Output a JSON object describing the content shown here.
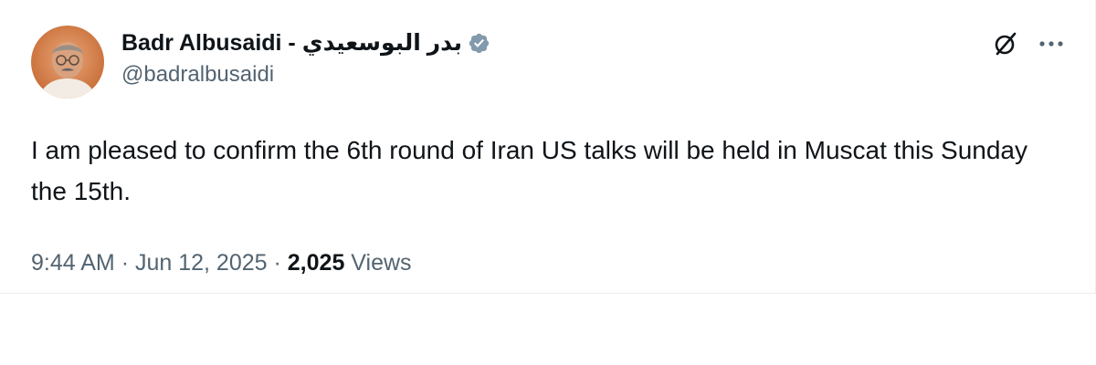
{
  "author": {
    "display_name": "Badr Albusaidi - بدر البوسعيدي",
    "handle": "@badralbusaidi",
    "verified": true,
    "avatar_icon": "profile-photo"
  },
  "actions": {
    "grok_icon": "grok-icon",
    "more_icon": "more-icon"
  },
  "tweet": {
    "text": "I am pleased to confirm the 6th round of Iran US talks will be held in Muscat this Sunday the 15th."
  },
  "meta": {
    "time": "9:44 AM",
    "separator": "·",
    "date": "Jun 12, 2025",
    "views_count": "2,025",
    "views_label": "Views"
  },
  "colors": {
    "text_primary": "#0f1419",
    "text_secondary": "#536471",
    "verified_badge": "#829aab"
  }
}
